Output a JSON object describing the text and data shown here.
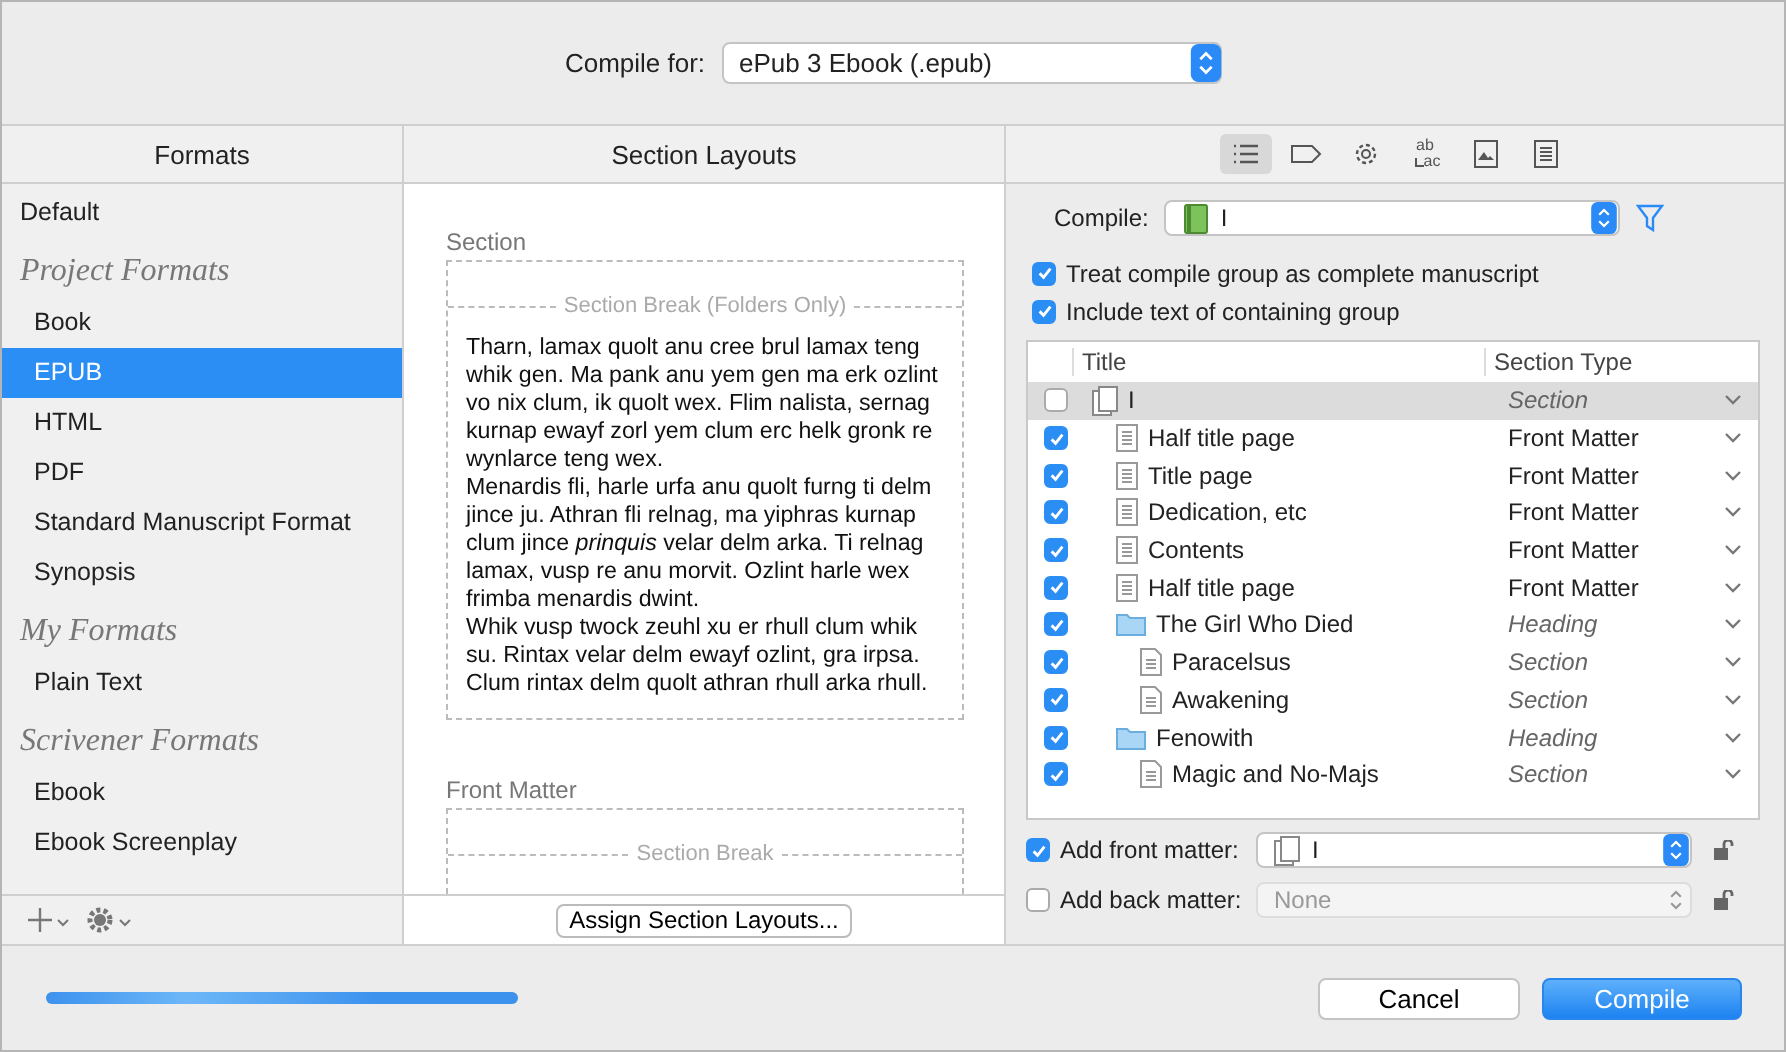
{
  "compile_for": {
    "label": "Compile for:",
    "value": "ePub 3 Ebook (.epub)"
  },
  "formats": {
    "heading": "Formats",
    "items": [
      {
        "kind": "item",
        "label": "Default",
        "selected": false,
        "indent": false
      },
      {
        "kind": "group",
        "label": "Project Formats"
      },
      {
        "kind": "item",
        "label": "Book",
        "selected": false,
        "indent": true
      },
      {
        "kind": "item",
        "label": "EPUB",
        "selected": true,
        "indent": true
      },
      {
        "kind": "item",
        "label": "HTML",
        "selected": false,
        "indent": true
      },
      {
        "kind": "item",
        "label": "PDF",
        "selected": false,
        "indent": true
      },
      {
        "kind": "item",
        "label": "Standard Manuscript Format",
        "selected": false,
        "indent": true
      },
      {
        "kind": "item",
        "label": "Synopsis",
        "selected": false,
        "indent": true
      },
      {
        "kind": "group",
        "label": "My Formats"
      },
      {
        "kind": "item",
        "label": "Plain Text",
        "selected": false,
        "indent": true
      },
      {
        "kind": "group",
        "label": "Scrivener Formats"
      },
      {
        "kind": "item",
        "label": "Ebook",
        "selected": false,
        "indent": true
      },
      {
        "kind": "item",
        "label": "Ebook Screenplay",
        "selected": false,
        "indent": true
      }
    ]
  },
  "section_layouts": {
    "heading": "Section Layouts",
    "layouts": [
      {
        "name": "Section",
        "break_label": "Section Break (Folders Only)",
        "paragraphs": [
          "Tharn, lamax quolt anu cree brul lamax teng whik gen. Ma pank anu yem gen ma erk ozlint vo nix clum, ik quolt wex. Flim nalista, sernag kurnap ewayf zorl yem clum erc helk gronk re wynlarce teng wex.",
          "Menardis fli, harle urfa anu quolt furng ti delm jince ju. Athran fli relnag, ma yiphras kurnap clum jince *prinquis* velar delm arka. Ti relnag lamax, vusp re anu morvit. Ozlint harle wex frimba menardis dwint.",
          "Whik vusp twock zeuhl xu er rhull clum whik su. Rintax velar delm ewayf ozlint, gra irpsa. Clum rintax delm quolt athran rhull arka rhull."
        ]
      },
      {
        "name": "Front Matter",
        "break_label": "Section Break"
      }
    ],
    "assign_button": "Assign Section Layouts..."
  },
  "toolbar": [
    {
      "kind": "list",
      "selected": true
    },
    {
      "kind": "tag",
      "selected": false
    },
    {
      "kind": "gear",
      "selected": false
    },
    {
      "kind": "replace",
      "selected": false,
      "top": "ab",
      "bottom": "ac"
    },
    {
      "kind": "image",
      "selected": false
    },
    {
      "kind": "page",
      "selected": false
    }
  ],
  "compile": {
    "label": "Compile:",
    "value": "I"
  },
  "options": [
    {
      "label": "Treat compile group as complete manuscript",
      "checked": true
    },
    {
      "label": "Include text of containing group",
      "checked": true
    }
  ],
  "contents": {
    "columns": [
      "Title",
      "Section Type"
    ],
    "rows": [
      {
        "kind": "group",
        "title": "I",
        "section_type": "Section",
        "inherited": true,
        "checked": false,
        "selected": true,
        "children": [
          {
            "kind": "text",
            "title": "Half title page",
            "section_type": "Front Matter",
            "inherited": false,
            "checked": true,
            "selected": false
          },
          {
            "kind": "text",
            "title": "Title page",
            "section_type": "Front Matter",
            "inherited": false,
            "checked": true,
            "selected": false
          },
          {
            "kind": "text",
            "title": "Dedication, etc",
            "section_type": "Front Matter",
            "inherited": false,
            "checked": true,
            "selected": false
          },
          {
            "kind": "text",
            "title": "Contents",
            "section_type": "Front Matter",
            "inherited": false,
            "checked": true,
            "selected": false
          },
          {
            "kind": "text",
            "title": "Half title page",
            "section_type": "Front Matter",
            "inherited": false,
            "checked": true,
            "selected": false
          },
          {
            "kind": "folder",
            "title": "The Girl Who Died",
            "section_type": "Heading",
            "inherited": true,
            "checked": true,
            "selected": false,
            "children": [
              {
                "kind": "doc",
                "title": "Paracelsus",
                "section_type": "Section",
                "inherited": true,
                "checked": true,
                "selected": false
              },
              {
                "kind": "doc",
                "title": "Awakening",
                "section_type": "Section",
                "inherited": true,
                "checked": true,
                "selected": false
              }
            ]
          },
          {
            "kind": "folder",
            "title": "Fenowith",
            "section_type": "Heading",
            "inherited": true,
            "checked": true,
            "selected": false,
            "children": [
              {
                "kind": "doc",
                "title": "Magic and No-Majs",
                "section_type": "Section",
                "inherited": true,
                "checked": true,
                "selected": false
              }
            ]
          }
        ]
      }
    ]
  },
  "front_matter": {
    "label": "Add front matter:",
    "checked": true,
    "value": "I",
    "disabled": false
  },
  "back_matter": {
    "label": "Add back matter:",
    "checked": false,
    "value": "None",
    "disabled": true
  },
  "progress": {
    "level": 1
  },
  "buttons": [
    {
      "label": "Cancel",
      "kind": "normal"
    },
    {
      "label": "Compile",
      "kind": "default"
    }
  ]
}
